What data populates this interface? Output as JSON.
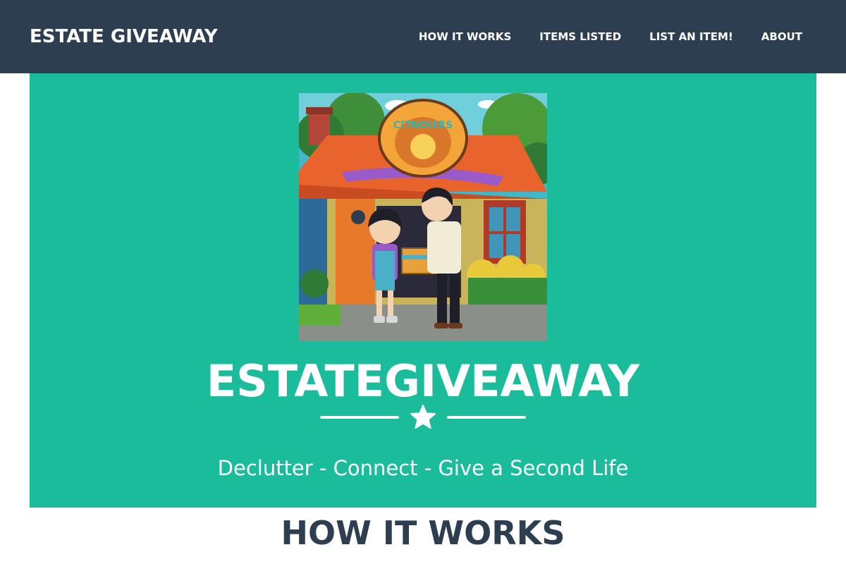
{
  "navbar": {
    "brand": "ESTATE GIVEAWAY",
    "links": [
      {
        "label": "HOW IT WORKS"
      },
      {
        "label": "ITEMS LISTED"
      },
      {
        "label": "LIST AN ITEM!"
      },
      {
        "label": "ABOUT"
      }
    ]
  },
  "masthead": {
    "illustration_sign": "CITNOIERS",
    "heading": "ESTATEGIVEAWAY",
    "divider_icon": "star-icon",
    "subheading": "Declutter - Connect - Give a Second Life"
  },
  "sections": {
    "how_it_works_heading": "HOW IT WORKS"
  },
  "colors": {
    "navbar_bg": "#2c3e50",
    "masthead_bg": "#1abc9c",
    "heading_dark": "#2c3e50",
    "text_light": "#ffffff"
  }
}
